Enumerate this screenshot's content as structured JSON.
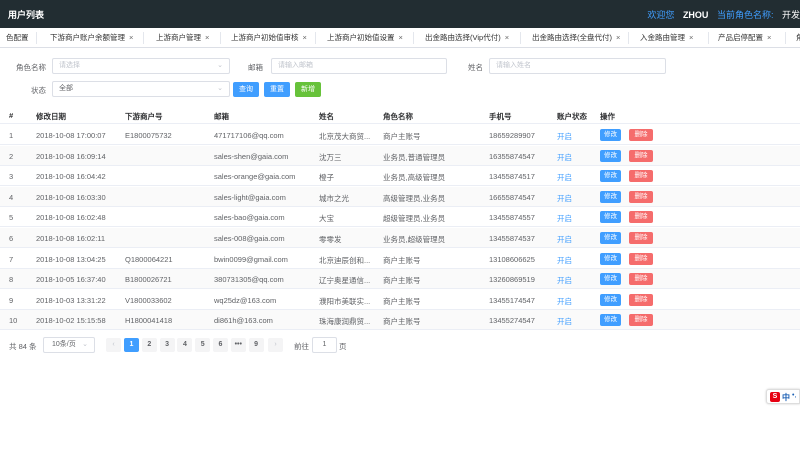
{
  "header": {
    "title": "用户列表",
    "welcome": "欢迎您",
    "username": "ZHOU",
    "role_label": "当前角色名称:",
    "dev": "开发"
  },
  "tabs": [
    {
      "label": "色配置",
      "closable": false
    },
    {
      "label": "下游商户账户余额管理",
      "closable": true
    },
    {
      "label": "上游商户管理",
      "closable": true
    },
    {
      "label": "上游商户初始值审核",
      "closable": true
    },
    {
      "label": "上游商户初始值设置",
      "closable": true
    },
    {
      "label": "出金路由选择(Vip代付)",
      "closable": true
    },
    {
      "label": "出金路由选择(全盘代付)",
      "closable": true
    },
    {
      "label": "入金路由管理",
      "closable": true
    },
    {
      "label": "产品启停配置",
      "closable": true
    },
    {
      "label": "角",
      "closable": false
    }
  ],
  "filters": {
    "role_label": "角色名称",
    "role_placeholder": "请选择",
    "email_label": "邮箱",
    "email_placeholder": "请输入邮箱",
    "name_label": "姓名",
    "name_placeholder": "请输入姓名",
    "status_label": "状态",
    "status_value": "全部",
    "query_btn": "查询",
    "reset_btn": "重置",
    "add_btn": "新增"
  },
  "table": {
    "headers": [
      "#",
      "修改日期",
      "下游商户号",
      "邮箱",
      "姓名",
      "角色名称",
      "手机号",
      "账户状态",
      "操作"
    ],
    "edit_label": "修改",
    "delete_label": "删除",
    "rows": [
      {
        "idx": "1",
        "date": "2018-10-08 17:00:07",
        "merchant": "E1800075732",
        "email": "471717106@qq.com",
        "name": "北京茂大商贸...",
        "role": "商户主账号",
        "phone": "18659289907",
        "status": "开启"
      },
      {
        "idx": "2",
        "date": "2018-10-08 16:09:14",
        "merchant": "",
        "email": "sales-shen@gaia.com",
        "name": "沈万三",
        "role": "业务员,普通管理员",
        "phone": "16355874547",
        "status": "开启"
      },
      {
        "idx": "3",
        "date": "2018-10-08 16:04:42",
        "merchant": "",
        "email": "sales-orange@gaia.com",
        "name": "橙子",
        "role": "业务员,高级管理员",
        "phone": "13455874517",
        "status": "开启"
      },
      {
        "idx": "4",
        "date": "2018-10-08 16:03:30",
        "merchant": "",
        "email": "sales-light@gaia.com",
        "name": "城市之光",
        "role": "高级管理员,业务员",
        "phone": "16655874547",
        "status": "开启"
      },
      {
        "idx": "5",
        "date": "2018-10-08 16:02:48",
        "merchant": "",
        "email": "sales-bao@gaia.com",
        "name": "大宝",
        "role": "超级管理员,业务员",
        "phone": "13455874557",
        "status": "开启"
      },
      {
        "idx": "6",
        "date": "2018-10-08 16:02:11",
        "merchant": "",
        "email": "sales-008@gaia.com",
        "name": "零零发",
        "role": "业务员,超级管理员",
        "phone": "13455874537",
        "status": "开启"
      },
      {
        "idx": "7",
        "date": "2018-10-08 13:04:25",
        "merchant": "Q1800064221",
        "email": "bwin0099@gmail.com",
        "name": "北京迪辰创和...",
        "role": "商户主账号",
        "phone": "13108606625",
        "status": "开启"
      },
      {
        "idx": "8",
        "date": "2018-10-05 16:37:40",
        "merchant": "B1800026721",
        "email": "380731305@qq.com",
        "name": "辽宁奥星通信...",
        "role": "商户主账号",
        "phone": "13260869519",
        "status": "开启"
      },
      {
        "idx": "9",
        "date": "2018-10-03 13:31:22",
        "merchant": "V1800033602",
        "email": "wq25dz@163.com",
        "name": "濮阳市美联实...",
        "role": "商户主账号",
        "phone": "13455174547",
        "status": "开启"
      },
      {
        "idx": "10",
        "date": "2018-10-02 15:15:58",
        "merchant": "H1800041418",
        "email": "di861h@163.com",
        "name": "珠海康润鼎贸...",
        "role": "商户主账号",
        "phone": "13455274547",
        "status": "开启"
      }
    ]
  },
  "pagination": {
    "total": "共 84 条",
    "page_size": "10条/页",
    "pages": [
      "1",
      "2",
      "3",
      "4",
      "5",
      "6",
      "•••",
      "9"
    ],
    "current": "1",
    "goto_label": "前往",
    "goto_value": "1",
    "goto_unit": "页"
  },
  "ime": {
    "logo": "S",
    "lang": "中",
    "mark": "•,"
  },
  "colors": {
    "topbar": "#222d32",
    "accent": "#409eff",
    "danger": "#f56c6c",
    "success": "#67c23a"
  }
}
